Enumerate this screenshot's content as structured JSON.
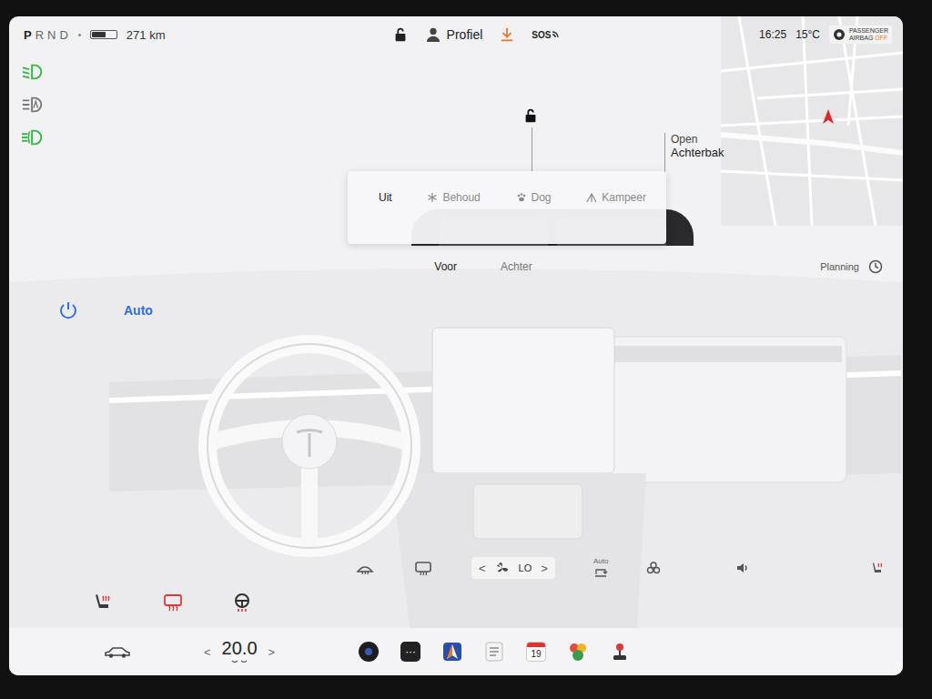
{
  "status_bar": {
    "gears": [
      {
        "label": "P",
        "selected": true
      },
      {
        "label": "R",
        "selected": false
      },
      {
        "label": "N",
        "selected": false
      },
      {
        "label": "D",
        "selected": false
      }
    ],
    "battery": {
      "level": 0.6
    },
    "range": "271 km",
    "profile": "Profiel",
    "sos": "SOS",
    "time": "16:25",
    "outside_temperature": "15°C",
    "airbag": {
      "lines": [
        "PASSENGER",
        "AIRBAG"
      ],
      "status": "OFF"
    }
  },
  "lights": [
    {
      "kind": "low-beam",
      "on": true
    },
    {
      "kind": "auto-high-beam",
      "on": false
    },
    {
      "kind": "fog",
      "on": true
    }
  ],
  "car_view": {
    "trunk": [
      "Open",
      "Achterbak"
    ]
  },
  "modes": [
    {
      "label": "Uit",
      "kind": "off",
      "selected": true
    },
    {
      "label": "Behoud",
      "kind": "keep",
      "selected": false
    },
    {
      "label": "Dog",
      "kind": "dog",
      "selected": false
    },
    {
      "label": "Kampeer",
      "kind": "camp",
      "selected": false
    }
  ],
  "climate": {
    "on": true,
    "auto": "Auto",
    "planning": "Planning",
    "zones": [
      {
        "label": "Voor",
        "selected": true
      },
      {
        "label": "Achter",
        "selected": false
      }
    ],
    "fan": {
      "prev": "<",
      "value": "LO",
      "next": ">"
    },
    "recirculation": "Auto",
    "heaters": [
      {
        "kind": "seat",
        "on": true
      },
      {
        "kind": "rear-defrost",
        "on": true
      },
      {
        "kind": "steering",
        "on": true
      }
    ]
  },
  "bottom_bar": {
    "cabin_temperature": "20.0",
    "prev": "<",
    "next": ">",
    "more": "···",
    "calendar_day": "19"
  }
}
